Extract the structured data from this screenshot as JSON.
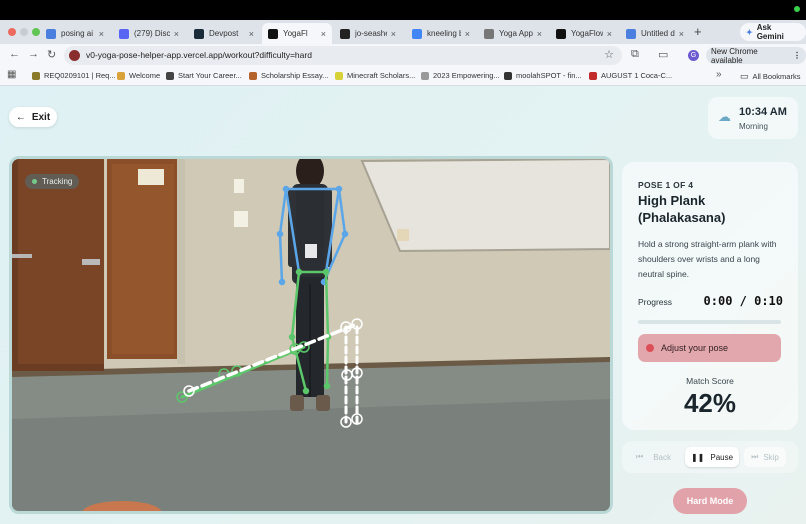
{
  "browser": {
    "tabs": [
      {
        "label": "posing ai",
        "icon": "docs-icon",
        "color": "#4a7fe0"
      },
      {
        "label": "(279) Disc",
        "icon": "discord-icon",
        "color": "#5865f2"
      },
      {
        "label": "Devpost",
        "icon": "devpost-icon",
        "color": "#1a2b3a"
      },
      {
        "label": "YogaFl",
        "icon": "vercel-icon",
        "color": "#111111"
      },
      {
        "label": "jo-seashel",
        "icon": "github-icon",
        "color": "#222222"
      },
      {
        "label": "kneeling b",
        "icon": "google-icon",
        "color": "#4285f4"
      },
      {
        "label": "Yoga App",
        "icon": "globe-icon",
        "color": "#777777"
      },
      {
        "label": "YogaFlow",
        "icon": "vercel-icon",
        "color": "#111111"
      },
      {
        "label": "Untitled d",
        "icon": "docs-icon",
        "color": "#4a7fe0"
      }
    ],
    "ask_gemini": "Ask Gemini",
    "url": "v0-yoga-pose-helper-app.vercel.app/workout?difficulty=hard",
    "chrome_available": "New Chrome available",
    "profile_initial": "G",
    "bookmarks": [
      {
        "label": "REQ0209101 | Req...",
        "color": "#8a7a2a"
      },
      {
        "label": "Welcome",
        "color": "#d9a23a"
      },
      {
        "label": "Start Your Career...",
        "color": "#444444"
      },
      {
        "label": "Scholarship Essay...",
        "color": "#b5632c"
      },
      {
        "label": "Minecraft Scholars...",
        "color": "#d8d23a"
      },
      {
        "label": "2023 Empowering...",
        "color": "#999999"
      },
      {
        "label": "moolahSPOT - fin...",
        "color": "#333333"
      },
      {
        "label": "AUGUST 1 Coca-C...",
        "color": "#c22b2b"
      }
    ],
    "all_bookmarks": "All Bookmarks"
  },
  "page": {
    "exit_label": "Exit",
    "time": "10:34 AM",
    "period": "Morning",
    "tracking_label": "Tracking",
    "pose_number": "POSE 1 OF 4",
    "pose_name": "High Plank (Phalakasana)",
    "description": "Hold a strong straight-arm plank with shoulders over wrists and a long neutral spine.",
    "progress_label": "Progress",
    "progress_time": "0:00 / 0:10",
    "progress_fraction": 0.0,
    "feedback": "Adjust your pose",
    "match_score_label": "Match Score",
    "match_score": "42%",
    "controls": {
      "back": "Back",
      "pause": "Pause",
      "skip": "Skip"
    },
    "difficulty_badge": "Hard Mode"
  },
  "colors": {
    "accent_pink": "#e2a2aa",
    "skeleton_blue": "#5aa6e8",
    "skeleton_green": "#5cc76a",
    "target_white": "#ffffff"
  }
}
